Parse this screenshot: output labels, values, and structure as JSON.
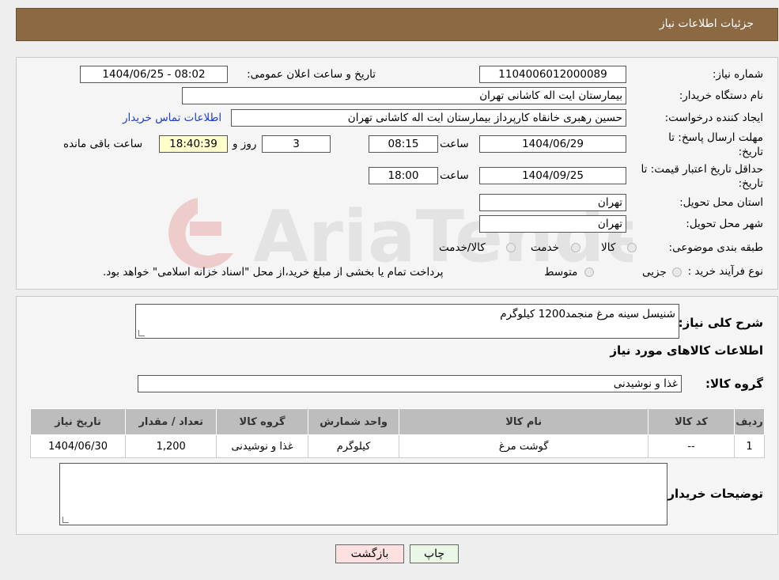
{
  "header": {
    "title": "جزئیات اطلاعات نیاز"
  },
  "form": {
    "need_number_label": "شماره نیاز:",
    "need_number": "1104006012000089",
    "announce_label": "تاریخ و ساعت اعلان عمومی:",
    "announce_value": "1404/06/25 - 08:02",
    "buyer_org_label": "نام دستگاه خریدار:",
    "buyer_org": "بیمارستان ایت اله کاشانی تهران",
    "creator_label": "ایجاد کننده درخواست:",
    "creator": "حسین رهبری خانقاه کارپرداز بیمارستان ایت اله کاشانی تهران",
    "contact_link": "اطلاعات تماس خریدار",
    "deadline_label": "مهلت ارسال پاسخ: تا تاریخ:",
    "deadline_date": "1404/06/29",
    "time_label": "ساعت",
    "deadline_time": "08:15",
    "days": "3",
    "days_label": "روز و",
    "remaining": "18:40:39",
    "remaining_label": "ساعت باقی مانده",
    "validity_label": "حداقل تاریخ اعتبار قیمت: تا تاریخ:",
    "validity_date": "1404/09/25",
    "validity_time": "18:00",
    "province_label": "استان محل تحویل:",
    "province": "تهران",
    "city_label": "شهر محل تحویل:",
    "city": "تهران",
    "category_label": "طبقه بندی موضوعی:",
    "category_options": [
      "کالا",
      "خدمت",
      "کالا/خدمت"
    ],
    "process_label": "نوع فرآیند خرید :",
    "process_options": [
      "جزیی",
      "متوسط"
    ],
    "process_note": "پرداخت تمام یا بخشی از مبلغ خرید،از محل \"اسناد خزانه اسلامی\" خواهد بود."
  },
  "details": {
    "description_label": "شرح کلی نیاز:",
    "description": "شنیسل سینه مرغ منجمد1200 کیلوگرم",
    "goods_info_title": "اطلاعات کالاهای مورد نیاز",
    "goods_group_label": "گروه کالا:",
    "goods_group": "غذا و نوشیدنی"
  },
  "table": {
    "headers": [
      "ردیف",
      "کد کالا",
      "نام کالا",
      "واحد شمارش",
      "گروه کالا",
      "تعداد / مقدار",
      "تاریخ نیاز"
    ],
    "rows": [
      [
        "1",
        "--",
        "گوشت مرغ",
        "کیلوگرم",
        "غذا و نوشیدنی",
        "1,200",
        "1404/06/30"
      ]
    ]
  },
  "buyer_notes_label": "توضیحات خریدار:",
  "buttons": {
    "print": "چاپ",
    "back": "بازگشت"
  },
  "watermark": "AriaTender.neT",
  "colors": {
    "header_bg": "#8b6a43",
    "link": "#1a3ccf",
    "remaining_bg": "#ffffcc",
    "back_bg": "#fde0e0",
    "print_bg": "#eaf6e6"
  }
}
